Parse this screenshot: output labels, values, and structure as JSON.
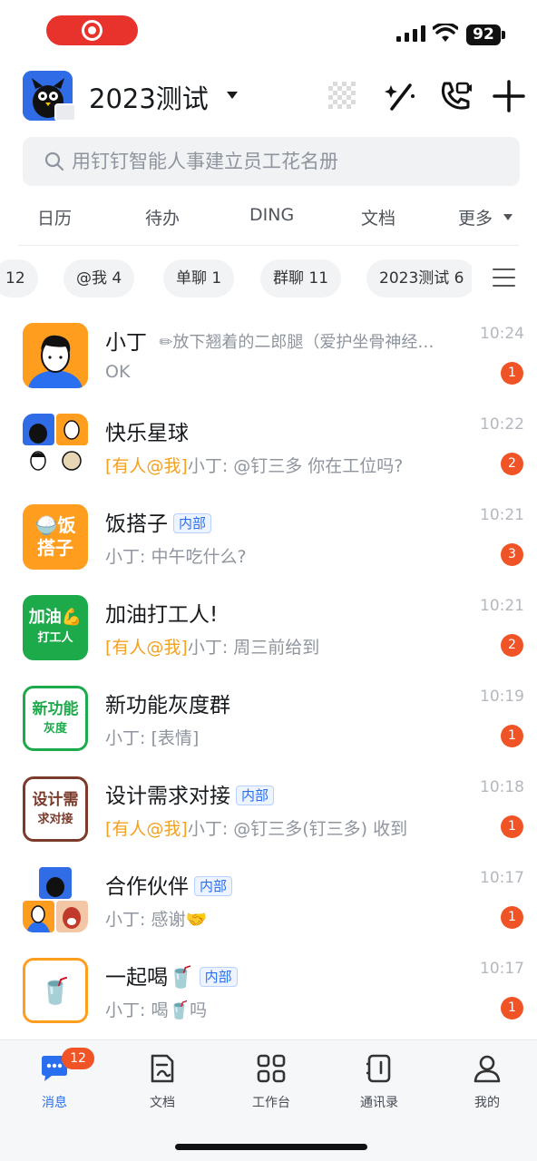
{
  "status_bar": {
    "battery": "92"
  },
  "header": {
    "org_name": "2023测试"
  },
  "search": {
    "placeholder": "用钉钉智能人事建立员工花名册"
  },
  "quick_links": [
    "日历",
    "待办",
    "DING",
    "文档",
    "更多"
  ],
  "filters": [
    "12",
    "@我 4",
    "单聊 1",
    "群聊 11",
    "2023测试 6"
  ],
  "conversations": [
    {
      "name": "小丁",
      "inline_preview": "放下翘着的二郎腿（爱护坐骨神经…",
      "mention": "",
      "message": "OK",
      "time": "10:24",
      "unread": "1",
      "tag": ""
    },
    {
      "name": "快乐星球",
      "inline_preview": "",
      "mention": "[有人@我]",
      "message": "小丁: @钉三多 你在工位吗?",
      "time": "10:22",
      "unread": "2",
      "tag": ""
    },
    {
      "name": "饭搭子",
      "inline_preview": "",
      "mention": "",
      "message": "小丁: 中午吃什么?",
      "time": "10:21",
      "unread": "3",
      "tag": "内部"
    },
    {
      "name": "加油打工人!",
      "inline_preview": "",
      "mention": "[有人@我]",
      "message": "小丁: 周三前给到",
      "time": "10:21",
      "unread": "2",
      "tag": ""
    },
    {
      "name": "新功能灰度群",
      "inline_preview": "",
      "mention": "",
      "message": "小丁: [表情]",
      "time": "10:19",
      "unread": "1",
      "tag": ""
    },
    {
      "name": "设计需求对接",
      "inline_preview": "",
      "mention": "[有人@我]",
      "message": "小丁: @钉三多(钉三多) 收到",
      "time": "10:18",
      "unread": "1",
      "tag": "内部"
    },
    {
      "name": "合作伙伴",
      "inline_preview": "",
      "mention": "",
      "message": "小丁: 感谢🤝",
      "time": "10:17",
      "unread": "1",
      "tag": "内部"
    },
    {
      "name": "一起喝🥤",
      "inline_preview": "",
      "mention": "",
      "message": "小丁: 喝🥤吗",
      "time": "10:17",
      "unread": "1",
      "tag": "内部"
    }
  ],
  "avatar_text": {
    "fan_line1": "🍚饭",
    "fan_line2": "搭子",
    "jiayou_line1": "加油💪",
    "jiayou_line2": "打工人",
    "xgn_line1": "新功能",
    "xgn_line2": "灰度",
    "sj_line1": "设计需",
    "sj_line2": "求对接",
    "drink": "🥤"
  },
  "tabbar": {
    "items": [
      "消息",
      "文档",
      "工作台",
      "通讯录",
      "我的"
    ],
    "message_badge": "12"
  },
  "colors": {
    "accent": "#2a6ff0",
    "badge": "#f05426",
    "mention": "#f6a020"
  }
}
